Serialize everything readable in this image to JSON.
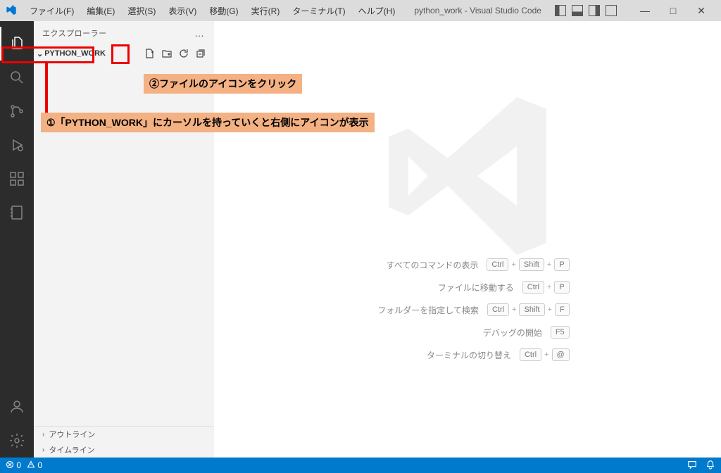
{
  "titlebar": {
    "title": "python_work - Visual Studio Code",
    "menu": [
      "ファイル(F)",
      "編集(E)",
      "選択(S)",
      "表示(V)",
      "移動(G)",
      "実行(R)",
      "ターミナル(T)",
      "ヘルプ(H)"
    ]
  },
  "sidebar": {
    "header": "エクスプローラー",
    "more": "…",
    "folder_name": "PYTHON_WORK",
    "outline": "アウトライン",
    "timeline": "タイムライン"
  },
  "annotations": {
    "line1": "①「PYTHON_WORK」にカーソルを持っていくと右側にアイコンが表示",
    "line2": "②ファイルのアイコンをクリック"
  },
  "commands": [
    {
      "label": "すべてのコマンドの表示",
      "keys": [
        "Ctrl",
        "Shift",
        "P"
      ]
    },
    {
      "label": "ファイルに移動する",
      "keys": [
        "Ctrl",
        "P"
      ]
    },
    {
      "label": "フォルダーを指定して検索",
      "keys": [
        "Ctrl",
        "Shift",
        "F"
      ]
    },
    {
      "label": "デバッグの開始",
      "keys": [
        "F5"
      ]
    },
    {
      "label": "ターミナルの切り替え",
      "keys": [
        "Ctrl",
        "@"
      ]
    }
  ],
  "statusbar": {
    "errors": "0",
    "warnings": "0"
  }
}
